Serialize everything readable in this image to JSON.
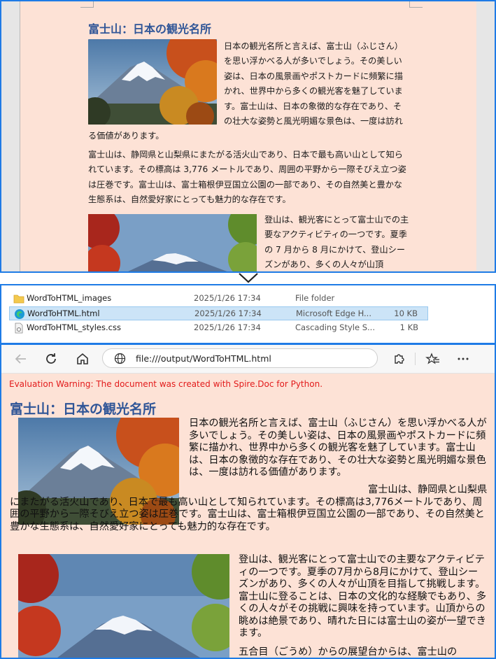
{
  "document": {
    "title": "富士山：日本の観光名所",
    "paragraph1": "日本の観光名所と言えば、富士山（ふじさん）を思い浮かべる人が多いでしょう。その美しい姿は、日本の風景画やポストカードに頻繁に描かれ、世界中から多くの観光客を魅了しています。富士山は、日本の象徴的な存在であり、その壮大な姿勢と風光明媚な景色は、一度は訪れる価値があります。",
    "paragraph2_word": "富士山は、静岡県と山梨県にまたがる活火山であり、日本で最も高い山として知られています。その標高は 3,776 メートルであり、周囲の平野から一際そびえ立つ姿は圧巻です。富士山は、富士箱根伊豆国立公園の一部であり、その自然美と豊かな生態系は、自然愛好家にとっても魅力的な存在です。",
    "paragraph3_word": "登山は、観光客にとって富士山での主要なアクティビティの一つです。夏季の 7 月から 8 月にかけて、登山シーズンがあり、多くの人々が山頂"
  },
  "explorer": {
    "files": [
      {
        "name": "WordToHTML_images",
        "date": "2025/1/26 17:34",
        "type": "File folder",
        "size": "",
        "icon": "folder-icon"
      },
      {
        "name": "WordToHTML.html",
        "date": "2025/1/26 17:34",
        "type": "Microsoft Edge H...",
        "size": "10 KB",
        "icon": "edge-icon"
      },
      {
        "name": "WordToHTML_styles.css",
        "date": "2025/1/26 17:34",
        "type": "Cascading Style S...",
        "size": "1 KB",
        "icon": "css-file-icon"
      }
    ]
  },
  "browser": {
    "url": "file:///output/WordToHTML.html",
    "warning": "Evaluation Warning: The document was created with Spire.Doc for Python.",
    "title": "富士山：日本の観光名所",
    "paragraph1": "日本の観光名所と言えば、富士山（ふじさん）を思い浮かべる人が多いでしょう。その美しい姿は、日本の風景画やポストカードに頻繁に描かれ、世界中から多くの観光客を魅了しています。富士山は、日本の象徴的な存在であり、その壮大な姿勢と風光明媚な景色は、一度は訪れる価値があります。",
    "paragraph2": "富士山は、静岡県と山梨県にまたがる活火山であり、日本で最も高い山として知られています。その標高は3,776メートルであり、周囲の平野から一際そびえ立つ姿は圧巻です。富士山は、富士箱根伊豆国立公園の一部であり、その自然美と豊かな生態系は、自然愛好家にとっても魅力的な存在です。",
    "paragraph3": "登山は、観光客にとって富士山での主要なアクティビティの一つです。夏季の7月から8月にかけて、登山シーズンがあり、多くの人々が山頂を目指して挑戦します。富士山に登ることは、日本の文化的な経験でもあり、多くの人々がその挑戦に興味を持っています。山頂からの眺めは絶景であり、晴れた日には富士山の姿が一望できます。",
    "paragraph4": "五合目（ごうめ）からの展望台からは、富士山の"
  },
  "colors": {
    "page_background": "#fde2d6",
    "title_blue": "#2f5597",
    "warning_red": "#e21b1b",
    "frame_blue": "#1e7be6",
    "selection": "#cce4f7"
  }
}
